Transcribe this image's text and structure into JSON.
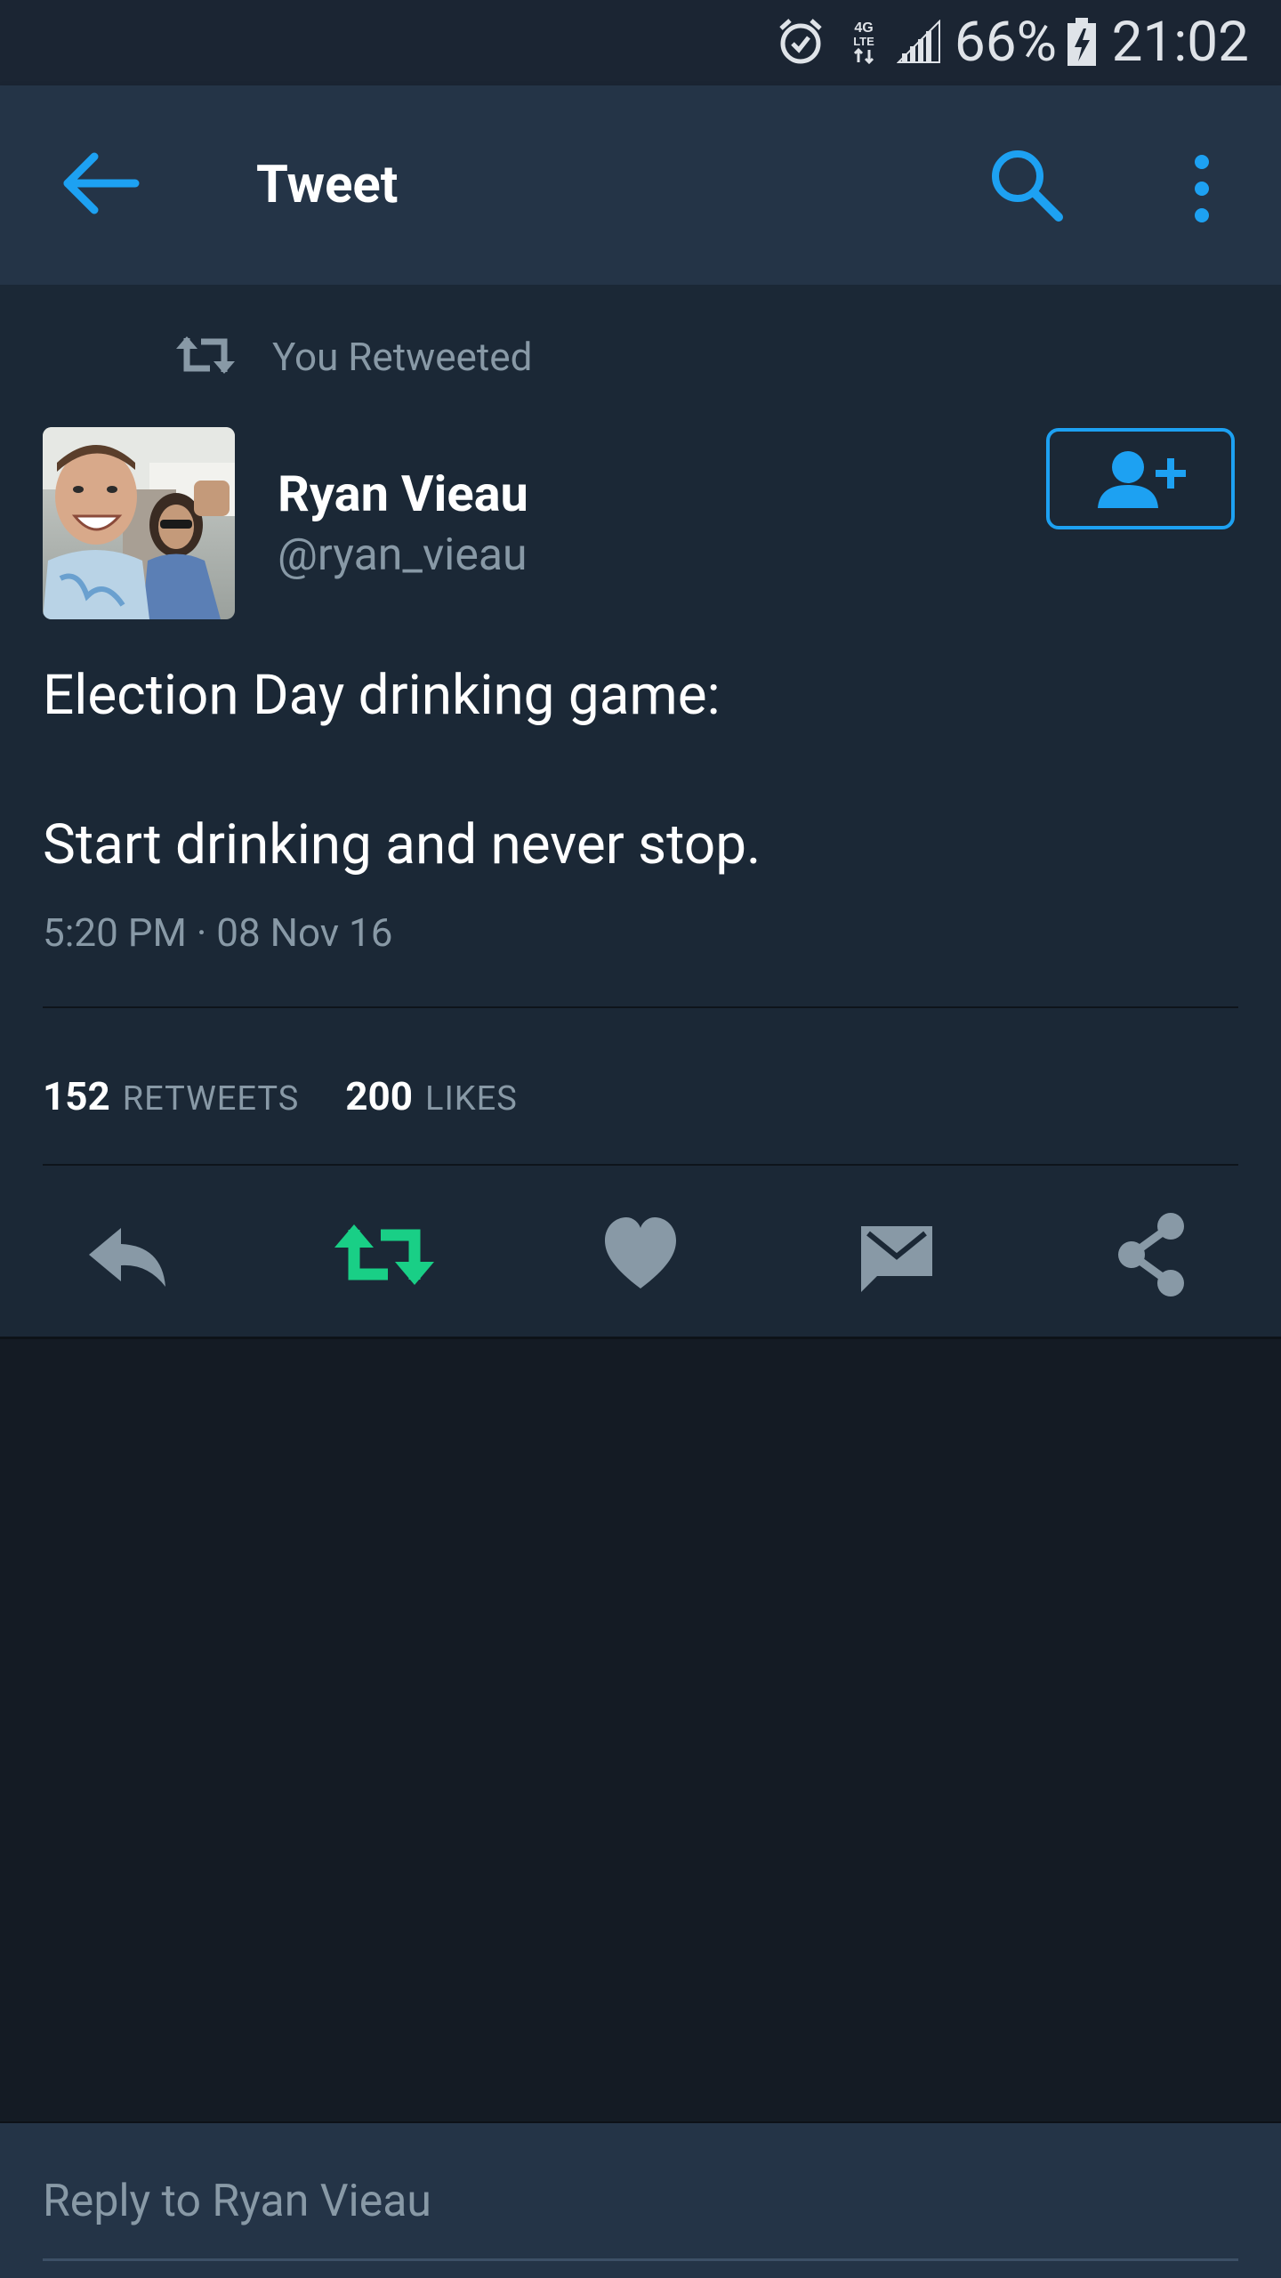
{
  "status_bar": {
    "battery_percent": "66%",
    "time": "21:02",
    "network": "4G LTE",
    "icons": [
      "alarm-icon",
      "network-4g-icon",
      "signal-icon",
      "battery-charging-icon"
    ]
  },
  "toolbar": {
    "title": "Tweet",
    "back_icon": "back-arrow-icon",
    "search_icon": "search-icon",
    "more_icon": "overflow-menu-icon"
  },
  "tweet": {
    "retweet_context": "You Retweeted",
    "author": {
      "name": "Ryan Vieau",
      "handle": "@ryan_vieau"
    },
    "text_lines": [
      "Election Day drinking game:",
      "Start drinking and never stop."
    ],
    "timestamp": "5:20 PM · 08 Nov 16",
    "stats": {
      "retweets_count": "152",
      "retweets_label": "RETWEETS",
      "likes_count": "200",
      "likes_label": "LIKES"
    },
    "actions": [
      "reply-icon",
      "retweet-icon",
      "like-icon",
      "direct-message-icon",
      "share-icon"
    ],
    "retweeted": true
  },
  "reply": {
    "placeholder": "Reply to Ryan Vieau"
  },
  "colors": {
    "accent": "#1da1f2",
    "retweet_active": "#19cf86",
    "icon_muted": "#8899a6",
    "background_dark": "#141b24",
    "card_background": "#1b2836",
    "toolbar_background": "#243447"
  }
}
